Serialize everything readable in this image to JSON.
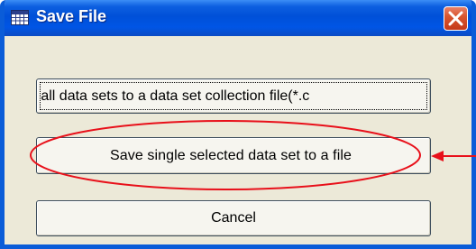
{
  "window": {
    "title": "Save File",
    "close_symbol": "✕"
  },
  "buttons": {
    "save_collection": "ve all data sets to a data set collection file(*.c",
    "save_single": "Save single selected  data set to a  file",
    "cancel": "Cancel"
  },
  "icons": {
    "title_icon": "table-icon",
    "close_icon": "close-icon"
  },
  "colors": {
    "annotation": "#e8101a",
    "titlebar": "#0050d8",
    "close": "#d9562f"
  }
}
